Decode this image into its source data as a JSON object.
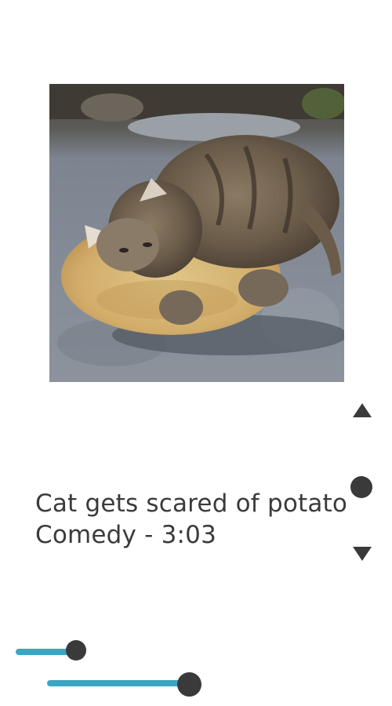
{
  "video": {
    "title": "Cat gets scared of potato",
    "meta": "Comedy - 3:03",
    "thumbnail_subject": "kitten hugging a potato"
  },
  "controls": {
    "scroll_up_icon": "triangle-up-icon",
    "scroll_position_icon": "circle-icon",
    "scroll_down_icon": "triangle-down-icon"
  },
  "sliders": [
    {
      "name": "slider-1",
      "value_fraction": 0.75
    },
    {
      "name": "slider-2",
      "value_fraction": 0.85
    }
  ],
  "colors": {
    "slider_track": "#3aa6c0",
    "knob": "#3a3a3a",
    "text": "#3b3b3b"
  }
}
